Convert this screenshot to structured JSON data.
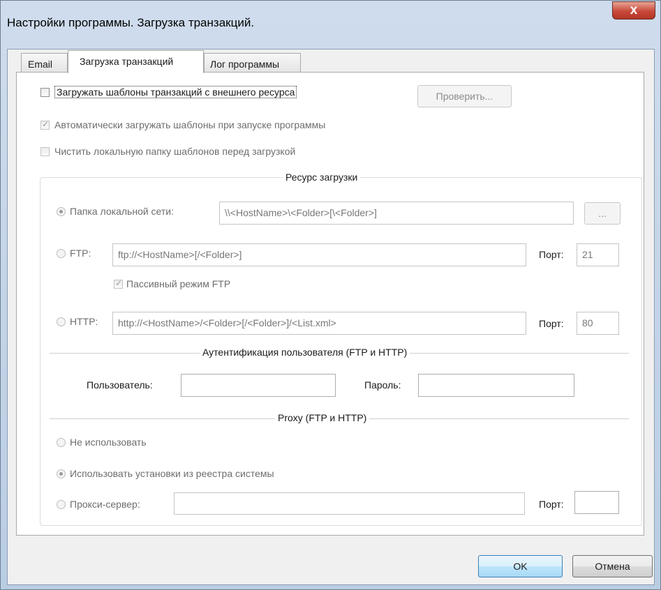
{
  "window": {
    "title": "Настройки программы. Загрузка транзакций.",
    "close_label": "x"
  },
  "tabs": [
    {
      "label": "Email"
    },
    {
      "label": "Загрузка транзакций"
    },
    {
      "label": "Лог программы"
    }
  ],
  "load_section": {
    "load_external_label": "Загружать шаблоны транзакций с внешнего ресурса",
    "check_button": "Проверить...",
    "auto_load_label": "Автоматически загружать шаблоны при запуске программы",
    "clean_folder_label": "Чистить локальную папку шаблонов перед загрузкой"
  },
  "resource": {
    "title": "Ресурс загрузки",
    "lan_label": "Папка локальной сети:",
    "lan_value": "\\\\<HostName>\\<Folder>[\\<Folder>]",
    "browse_button": "...",
    "ftp_label": "FTP:",
    "ftp_value": "ftp://<HostName>[/<Folder>]",
    "port_label": "Порт:",
    "ftp_port": "21",
    "passive_label": "Пассивный режим FTP",
    "http_label": "HTTP:",
    "http_value": "http://<HostName>/<Folder>[/<Folder>]/<List.xml>",
    "http_port": "80"
  },
  "auth": {
    "title": "Аутентификация пользователя (FTP и HTTP)",
    "user_label": "Пользователь:",
    "user_value": "",
    "password_label": "Пароль:",
    "password_value": ""
  },
  "proxy": {
    "title": "Proxy (FTP и HTTP)",
    "none_label": "Не использовать",
    "system_label": "Использовать установки из реестра системы",
    "server_label": "Прокси-сервер:",
    "server_value": "",
    "port_label": "Порт:",
    "port_value": ""
  },
  "footer": {
    "ok_button": "OK",
    "cancel_button": "Отмена"
  }
}
